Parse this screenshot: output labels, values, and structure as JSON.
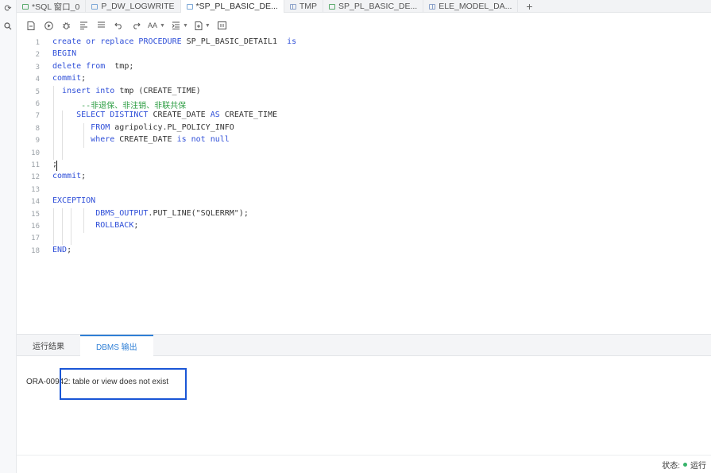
{
  "tabs": [
    {
      "label": "*SQL 窗口_0",
      "icon": "sql-window-icon"
    },
    {
      "label": "P_DW_LOGWRITE",
      "icon": "procedure-icon"
    },
    {
      "label": "*SP_PL_BASIC_DE...",
      "icon": "procedure-icon",
      "active": true
    },
    {
      "label": "TMP",
      "icon": "table-icon"
    },
    {
      "label": "SP_PL_BASIC_DE...",
      "icon": "procedure-icon"
    },
    {
      "label": "ELE_MODEL_DA...",
      "icon": "table-icon"
    }
  ],
  "tab_add_label": "+",
  "left_rail": {
    "refresh_icon": "refresh-icon",
    "search_icon": "search-icon"
  },
  "toolbar": {
    "items": [
      "save-icon",
      "run-icon",
      "debug-icon",
      "format-icon",
      "clean-icon",
      "undo-icon",
      "redo-icon",
      "font-icon",
      "indent-icon",
      "export-icon",
      "panel-icon"
    ]
  },
  "editor": {
    "line_numbers": [
      "1",
      "2",
      "3",
      "4",
      "5",
      "6",
      "7",
      "8",
      "9",
      "10",
      "11",
      "12",
      "13",
      "14",
      "15",
      "16",
      "17",
      "18"
    ]
  },
  "panel": {
    "tab_result": "运行结果",
    "tab_dbms": "DBMS 输出",
    "output": "ORA-00942: table or view does not exist"
  },
  "status": {
    "label": "状态:",
    "value": "运行",
    "color": "#36b36a"
  },
  "colors": {
    "keyword": "#2f4fd8",
    "comment": "#2e9e44",
    "accent": "#2f7fd6",
    "highlight_box": "#1a56d6"
  }
}
